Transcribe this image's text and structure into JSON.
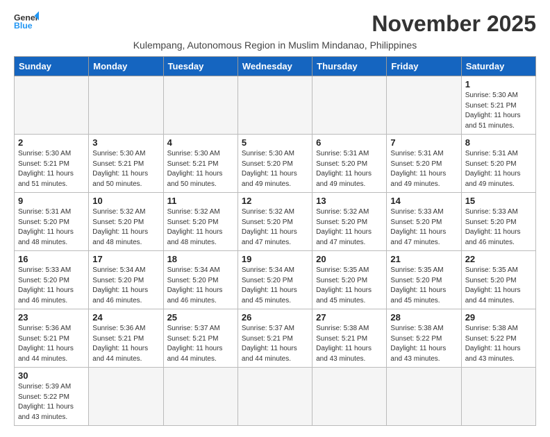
{
  "header": {
    "logo_line1": "General",
    "logo_line2": "Blue",
    "month_title": "November 2025",
    "subtitle": "Kulempang, Autonomous Region in Muslim Mindanao, Philippines"
  },
  "weekdays": [
    "Sunday",
    "Monday",
    "Tuesday",
    "Wednesday",
    "Thursday",
    "Friday",
    "Saturday"
  ],
  "weeks": [
    [
      {
        "day": "",
        "content": ""
      },
      {
        "day": "",
        "content": ""
      },
      {
        "day": "",
        "content": ""
      },
      {
        "day": "",
        "content": ""
      },
      {
        "day": "",
        "content": ""
      },
      {
        "day": "",
        "content": ""
      },
      {
        "day": "1",
        "content": "Sunrise: 5:30 AM\nSunset: 5:21 PM\nDaylight: 11 hours\nand 51 minutes."
      }
    ],
    [
      {
        "day": "2",
        "content": "Sunrise: 5:30 AM\nSunset: 5:21 PM\nDaylight: 11 hours\nand 51 minutes."
      },
      {
        "day": "3",
        "content": "Sunrise: 5:30 AM\nSunset: 5:21 PM\nDaylight: 11 hours\nand 50 minutes."
      },
      {
        "day": "4",
        "content": "Sunrise: 5:30 AM\nSunset: 5:21 PM\nDaylight: 11 hours\nand 50 minutes."
      },
      {
        "day": "5",
        "content": "Sunrise: 5:30 AM\nSunset: 5:20 PM\nDaylight: 11 hours\nand 49 minutes."
      },
      {
        "day": "6",
        "content": "Sunrise: 5:31 AM\nSunset: 5:20 PM\nDaylight: 11 hours\nand 49 minutes."
      },
      {
        "day": "7",
        "content": "Sunrise: 5:31 AM\nSunset: 5:20 PM\nDaylight: 11 hours\nand 49 minutes."
      },
      {
        "day": "8",
        "content": "Sunrise: 5:31 AM\nSunset: 5:20 PM\nDaylight: 11 hours\nand 49 minutes."
      }
    ],
    [
      {
        "day": "9",
        "content": "Sunrise: 5:31 AM\nSunset: 5:20 PM\nDaylight: 11 hours\nand 48 minutes."
      },
      {
        "day": "10",
        "content": "Sunrise: 5:32 AM\nSunset: 5:20 PM\nDaylight: 11 hours\nand 48 minutes."
      },
      {
        "day": "11",
        "content": "Sunrise: 5:32 AM\nSunset: 5:20 PM\nDaylight: 11 hours\nand 48 minutes."
      },
      {
        "day": "12",
        "content": "Sunrise: 5:32 AM\nSunset: 5:20 PM\nDaylight: 11 hours\nand 47 minutes."
      },
      {
        "day": "13",
        "content": "Sunrise: 5:32 AM\nSunset: 5:20 PM\nDaylight: 11 hours\nand 47 minutes."
      },
      {
        "day": "14",
        "content": "Sunrise: 5:33 AM\nSunset: 5:20 PM\nDaylight: 11 hours\nand 47 minutes."
      },
      {
        "day": "15",
        "content": "Sunrise: 5:33 AM\nSunset: 5:20 PM\nDaylight: 11 hours\nand 46 minutes."
      }
    ],
    [
      {
        "day": "16",
        "content": "Sunrise: 5:33 AM\nSunset: 5:20 PM\nDaylight: 11 hours\nand 46 minutes."
      },
      {
        "day": "17",
        "content": "Sunrise: 5:34 AM\nSunset: 5:20 PM\nDaylight: 11 hours\nand 46 minutes."
      },
      {
        "day": "18",
        "content": "Sunrise: 5:34 AM\nSunset: 5:20 PM\nDaylight: 11 hours\nand 46 minutes."
      },
      {
        "day": "19",
        "content": "Sunrise: 5:34 AM\nSunset: 5:20 PM\nDaylight: 11 hours\nand 45 minutes."
      },
      {
        "day": "20",
        "content": "Sunrise: 5:35 AM\nSunset: 5:20 PM\nDaylight: 11 hours\nand 45 minutes."
      },
      {
        "day": "21",
        "content": "Sunrise: 5:35 AM\nSunset: 5:20 PM\nDaylight: 11 hours\nand 45 minutes."
      },
      {
        "day": "22",
        "content": "Sunrise: 5:35 AM\nSunset: 5:20 PM\nDaylight: 11 hours\nand 44 minutes."
      }
    ],
    [
      {
        "day": "23",
        "content": "Sunrise: 5:36 AM\nSunset: 5:21 PM\nDaylight: 11 hours\nand 44 minutes."
      },
      {
        "day": "24",
        "content": "Sunrise: 5:36 AM\nSunset: 5:21 PM\nDaylight: 11 hours\nand 44 minutes."
      },
      {
        "day": "25",
        "content": "Sunrise: 5:37 AM\nSunset: 5:21 PM\nDaylight: 11 hours\nand 44 minutes."
      },
      {
        "day": "26",
        "content": "Sunrise: 5:37 AM\nSunset: 5:21 PM\nDaylight: 11 hours\nand 44 minutes."
      },
      {
        "day": "27",
        "content": "Sunrise: 5:38 AM\nSunset: 5:21 PM\nDaylight: 11 hours\nand 43 minutes."
      },
      {
        "day": "28",
        "content": "Sunrise: 5:38 AM\nSunset: 5:22 PM\nDaylight: 11 hours\nand 43 minutes."
      },
      {
        "day": "29",
        "content": "Sunrise: 5:38 AM\nSunset: 5:22 PM\nDaylight: 11 hours\nand 43 minutes."
      }
    ],
    [
      {
        "day": "30",
        "content": "Sunrise: 5:39 AM\nSunset: 5:22 PM\nDaylight: 11 hours\nand 43 minutes."
      },
      {
        "day": "",
        "content": ""
      },
      {
        "day": "",
        "content": ""
      },
      {
        "day": "",
        "content": ""
      },
      {
        "day": "",
        "content": ""
      },
      {
        "day": "",
        "content": ""
      },
      {
        "day": "",
        "content": ""
      }
    ]
  ]
}
